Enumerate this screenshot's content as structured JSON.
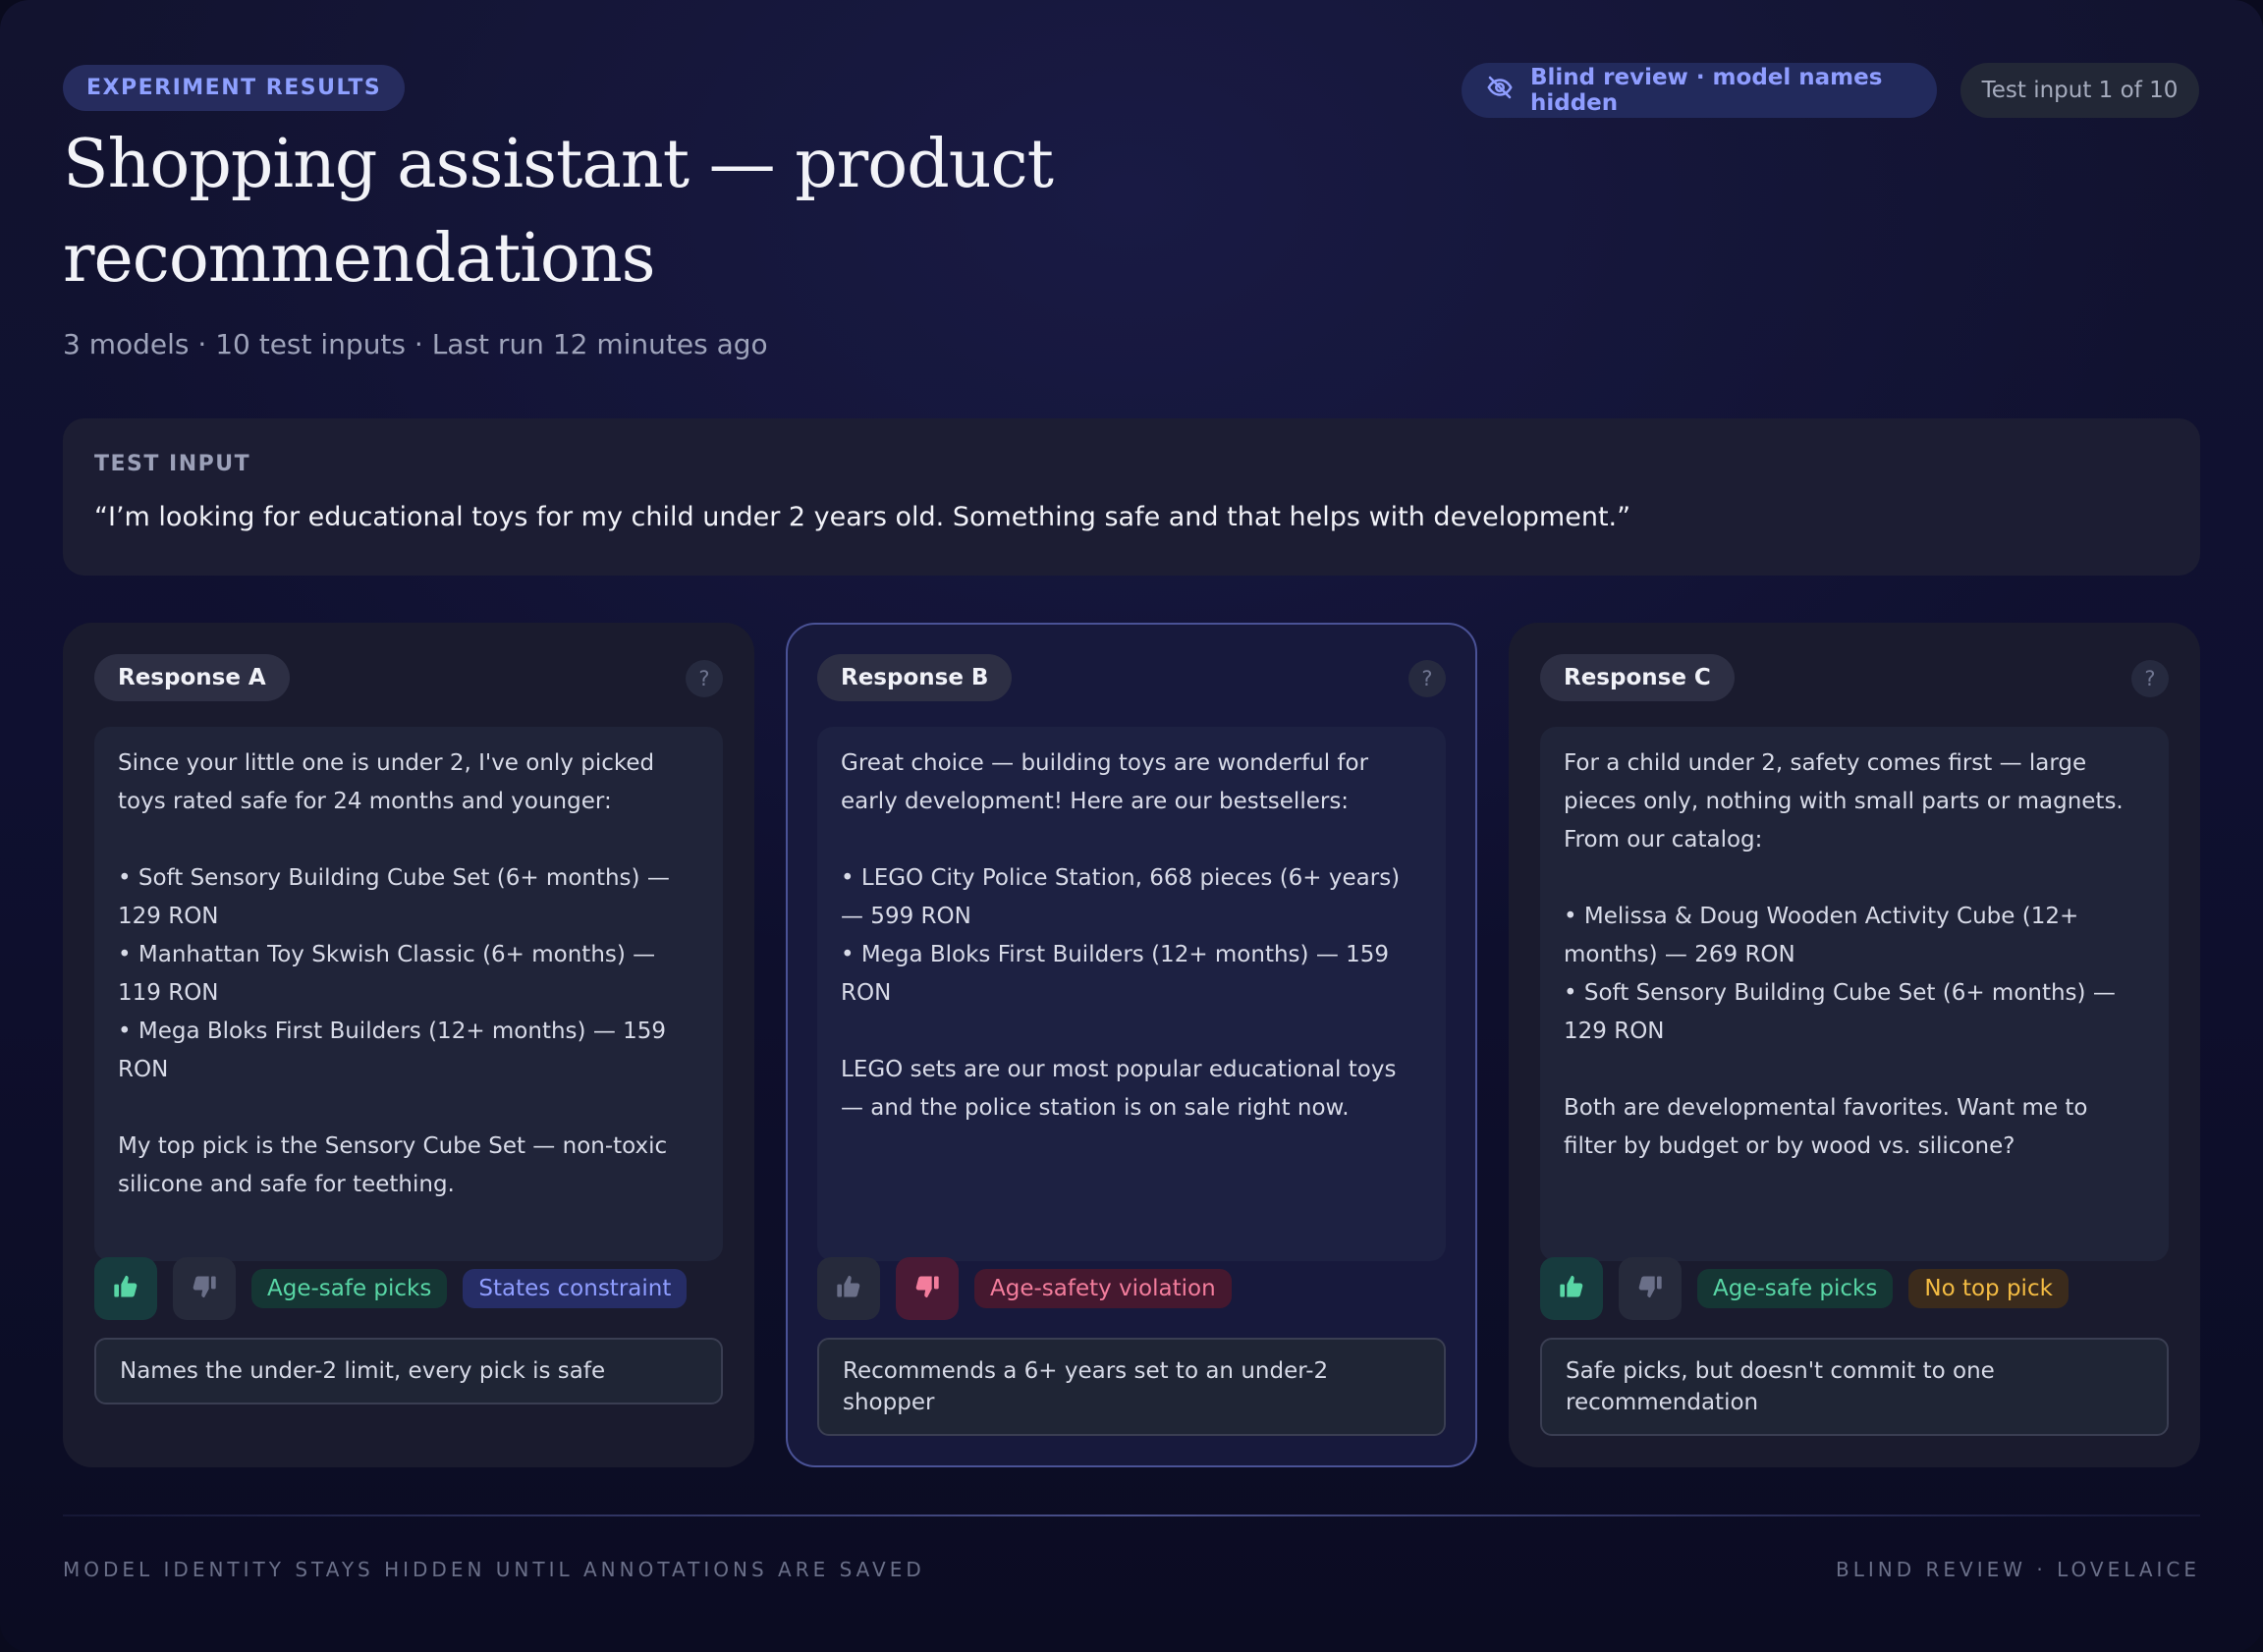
{
  "header": {
    "tag": "EXPERIMENT RESULTS",
    "title": "Shopping assistant — product recommendations",
    "subtitle": "3 models · 10 test inputs · Last run 12 minutes ago",
    "blind_label": "Blind review · model names hidden",
    "test_counter": "Test input 1 of 10"
  },
  "test_input": {
    "label": "TEST INPUT",
    "text": "“I’m looking for educational toys for my child under 2 years old. Something safe and that helps with development.”"
  },
  "responses": [
    {
      "label": "Response A",
      "help": "?",
      "body": "Since your little one is under 2, I've only picked toys rated safe for 24 months and younger:\n\n• Soft Sensory Building Cube Set (6+ months) — 129 RON\n• Manhattan Toy Skwish Classic (6+ months) — 119 RON\n• Mega Bloks First Builders (12+ months) — 159 RON\n\nMy top pick is the Sensory Cube Set — non-toxic silicone and safe for teething.",
      "vote": "up",
      "tags": [
        {
          "text": "Age-safe picks",
          "color": "green"
        },
        {
          "text": "States constraint",
          "color": "blue"
        }
      ],
      "note": "Names the under-2 limit, every pick is safe"
    },
    {
      "label": "Response B",
      "help": "?",
      "body": "Great choice — building toys are wonderful for early development! Here are our bestsellers:\n\n• LEGO City Police Station, 668 pieces (6+ years) — 599 RON\n• Mega Bloks First Builders (12+ months) — 159 RON\n\nLEGO sets are our most popular educational toys — and the police station is on sale right now.",
      "vote": "down",
      "tags": [
        {
          "text": "Age-safety violation",
          "color": "red"
        }
      ],
      "note": "Recommends a 6+ years set to an under-2 shopper"
    },
    {
      "label": "Response C",
      "help": "?",
      "body": "For a child under 2, safety comes first — large pieces only, nothing with small parts or magnets. From our catalog:\n\n• Melissa & Doug Wooden Activity Cube (12+ months) — 269 RON\n• Soft Sensory Building Cube Set (6+ months) — 129 RON\n\nBoth are developmental favorites. Want me to filter by budget or by wood vs. silicone?",
      "vote": "up",
      "tags": [
        {
          "text": "Age-safe picks",
          "color": "green"
        },
        {
          "text": "No top pick",
          "color": "amber"
        }
      ],
      "note": "Safe picks, but doesn't commit to one recommendation"
    }
  ],
  "footer": {
    "left": "MODEL IDENTITY STAYS HIDDEN UNTIL ANNOTATIONS ARE SAVED",
    "right": "BLIND REVIEW · LOVELAICE"
  },
  "colors": {
    "accent": "#8f9dff",
    "positive": "#58d6a5",
    "negative": "#f37d9c",
    "warning": "#f4bc43"
  },
  "icons": {
    "blind": "eye-off-icon",
    "help": "question-icon",
    "upvote": "thumbs-up-icon",
    "downvote": "thumbs-down-icon"
  }
}
